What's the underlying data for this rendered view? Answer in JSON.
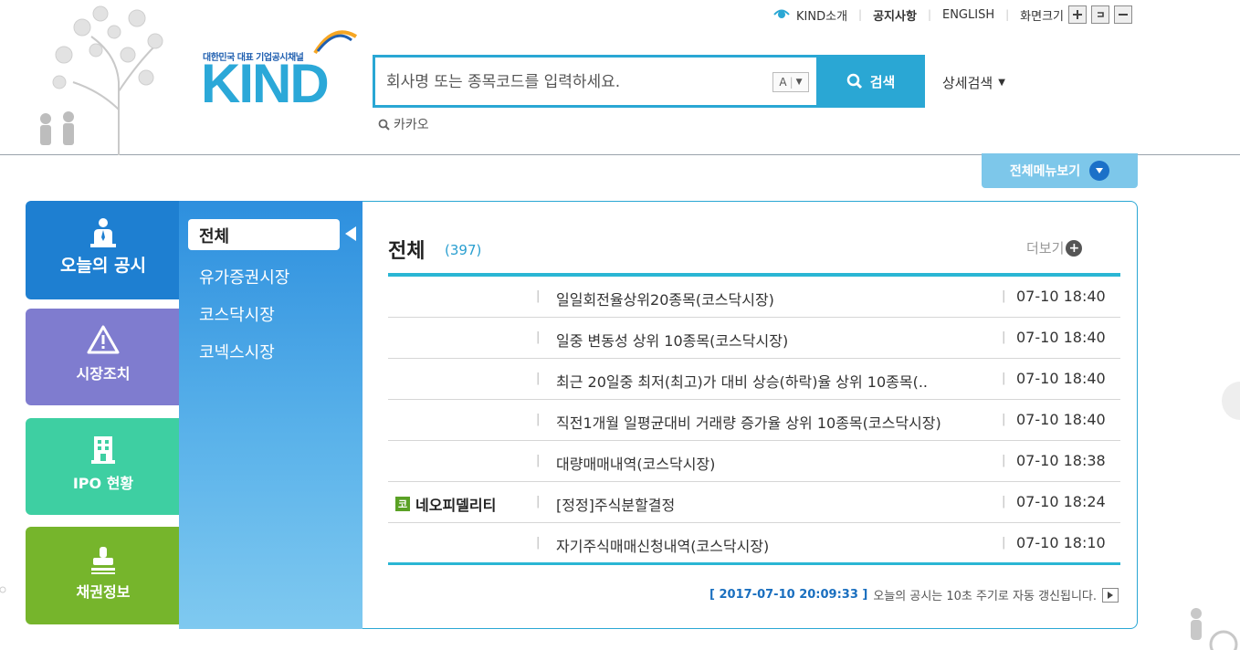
{
  "header": {
    "util_links": {
      "kind_intro": "KIND소개",
      "notice": "공지사항",
      "english": "ENGLISH",
      "screen_size": "화면크기"
    },
    "logo": {
      "tagline": "대한민국 대표 기업공시채널",
      "wordmark": "KIND"
    },
    "search": {
      "placeholder": "회사명 또는 종목코드를 입력하세요.",
      "lang_toggle": "A",
      "button_label": "검색",
      "advanced_label": "상세검색",
      "kakao_label": "카카오"
    },
    "all_menu_label": "전체메뉴보기"
  },
  "categories": [
    {
      "label": "오늘의 공시",
      "icon": "person-icon"
    },
    {
      "label": "시장조치",
      "icon": "warning-icon"
    },
    {
      "label": "IPO 현황",
      "icon": "building-icon"
    },
    {
      "label": "채권정보",
      "icon": "stamp-icon"
    }
  ],
  "subnav": {
    "active": "전체",
    "items": [
      "유가증권시장",
      "코스닥시장",
      "코넥스시장"
    ]
  },
  "main": {
    "title": "전체",
    "count": "(397)",
    "more_label": "더보기",
    "rows": [
      {
        "company": "",
        "badge": "",
        "title": "일일회전율상위20종목(코스닥시장)",
        "time": "07-10 18:40"
      },
      {
        "company": "",
        "badge": "",
        "title": "일중 변동성 상위 10종목(코스닥시장)",
        "time": "07-10 18:40"
      },
      {
        "company": "",
        "badge": "",
        "title": "최근 20일중 최저(최고)가 대비 상승(하락)율 상위 10종목(..",
        "time": "07-10 18:40"
      },
      {
        "company": "",
        "badge": "",
        "title": "직전1개월 일평균대비 거래량 증가율 상위 10종목(코스닥시장)",
        "time": "07-10 18:40"
      },
      {
        "company": "",
        "badge": "",
        "title": "대량매매내역(코스닥시장)",
        "time": "07-10 18:38"
      },
      {
        "company": "네오피델리티",
        "badge": "코",
        "title": "[정정]주식분할결정",
        "time": "07-10 18:24"
      },
      {
        "company": "",
        "badge": "",
        "title": "자기주식매매신청내역(코스닥시장)",
        "time": "07-10 18:10"
      }
    ],
    "refresh_timestamp": "[ 2017-07-10 20:09:33 ]",
    "refresh_text": "오늘의 공시는 10초 주기로 자동 갱신됩니다."
  },
  "colors": {
    "accent": "#2aa7d4",
    "today": "#1e7fd1",
    "market": "#7f7ccf",
    "ipo": "#3ecfa2",
    "bond": "#76b52c"
  }
}
